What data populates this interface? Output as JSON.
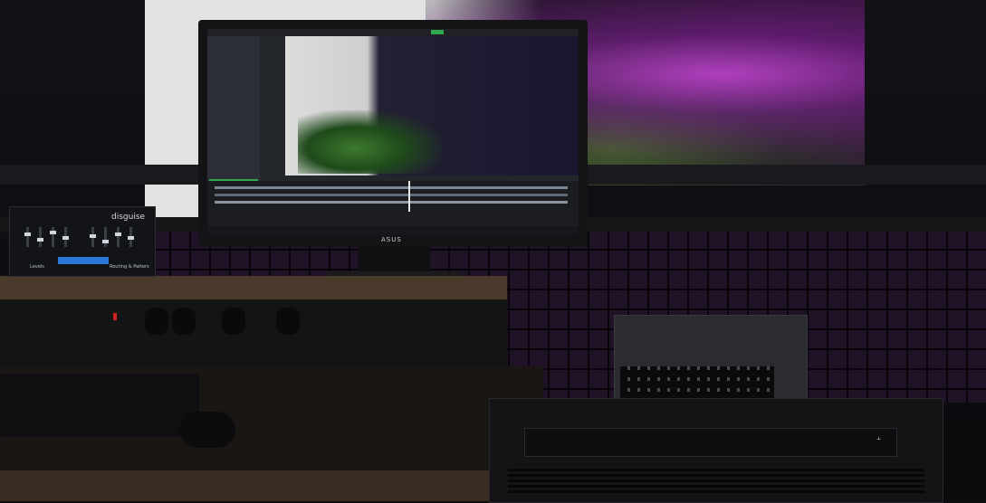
{
  "monitor": {
    "brand_text": "ASUS"
  },
  "control_unit": {
    "logo_text": "disguise",
    "label_left": "Levels",
    "label_right": "Routing & Patters"
  },
  "server": {
    "logo_text": "⫠"
  },
  "colors": {
    "projection_purple": "#b13fbf",
    "status_green": "#2fa84f",
    "control_blue": "#2b78d8",
    "power_red": "#d12020"
  }
}
